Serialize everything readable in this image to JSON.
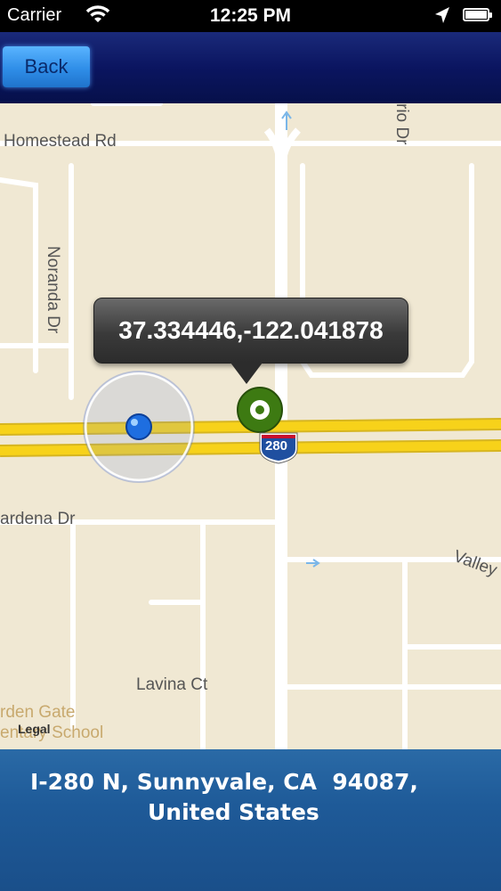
{
  "status_bar": {
    "carrier": "Carrier",
    "time": "12:25 PM",
    "icons": [
      "wifi-icon",
      "location-arrow-icon",
      "battery-icon"
    ]
  },
  "nav_bar": {
    "back_label": "Back"
  },
  "map": {
    "streets": [
      "Homestead Rd",
      "Noranda Dr",
      "rio Dr",
      "ardena Dr",
      "Valley Green",
      "Lavina Ct"
    ],
    "poi": [
      "rden Gate",
      "entary School"
    ],
    "highway_shield": "280",
    "legal": "Legal",
    "pin_callout": "37.334446,-122.041878",
    "colors": {
      "land": "#f0e8d3",
      "road": "#ffffff",
      "highway": "#f7d21a",
      "user_location": "#1e6ee0",
      "pin": "#3d7a12"
    }
  },
  "address": {
    "line1": "I-280 N, Sunnyvale, CA  94087,",
    "line2": "United States"
  }
}
